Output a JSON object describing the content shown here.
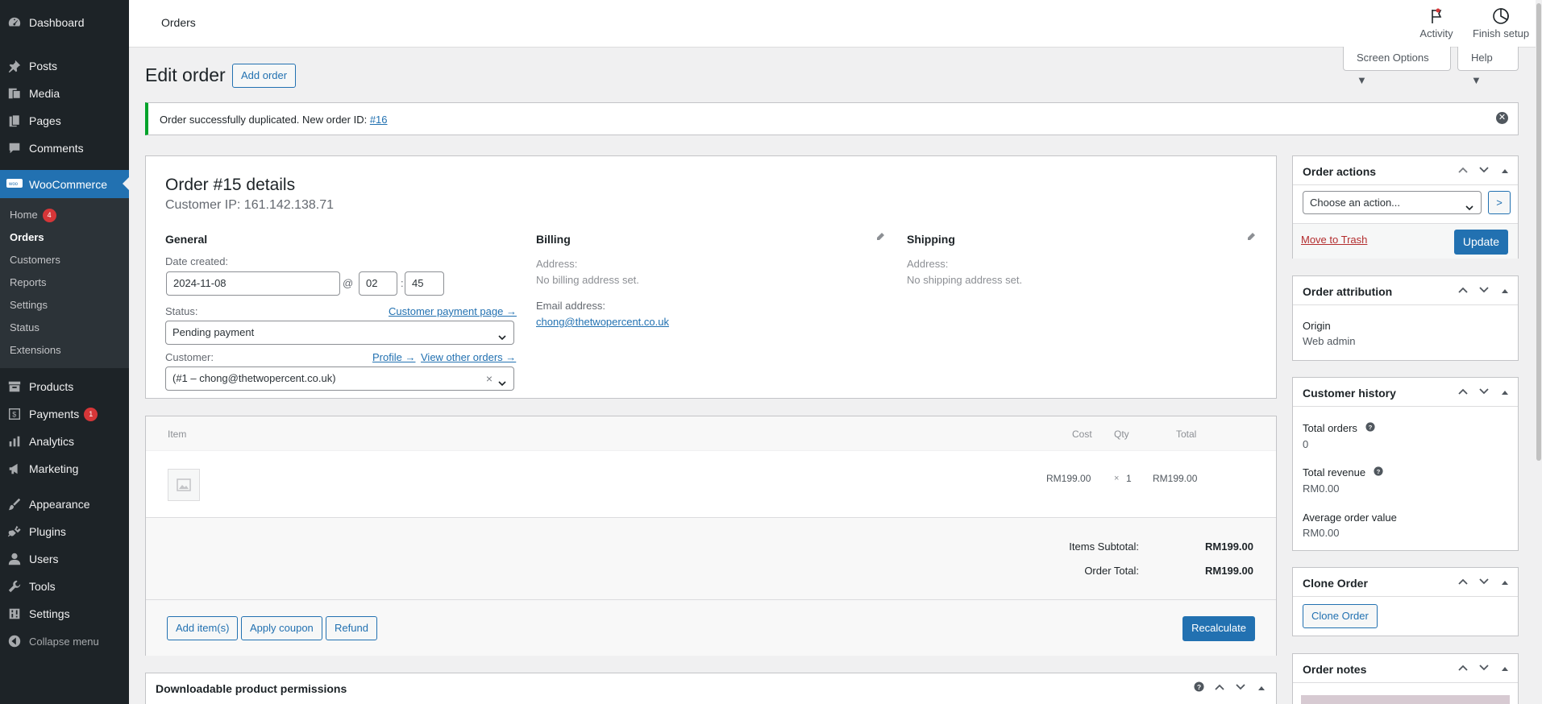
{
  "sidebar": {
    "top_items": [
      {
        "label": "Dashboard",
        "icon": "dashboard-icon"
      },
      {
        "label": "Posts",
        "icon": "pin-icon"
      },
      {
        "label": "Media",
        "icon": "media-icon"
      },
      {
        "label": "Pages",
        "icon": "pages-icon"
      },
      {
        "label": "Comments",
        "icon": "comments-icon"
      }
    ],
    "woocommerce": {
      "label": "WooCommerce",
      "icon": "woo-icon"
    },
    "submenu": [
      {
        "label": "Home",
        "badge": "4"
      },
      {
        "label": "Orders"
      },
      {
        "label": "Customers"
      },
      {
        "label": "Reports"
      },
      {
        "label": "Settings"
      },
      {
        "label": "Status"
      },
      {
        "label": "Extensions"
      }
    ],
    "bottom_items": [
      {
        "label": "Products",
        "icon": "archive-icon"
      },
      {
        "label": "Payments",
        "badge": "1",
        "icon": "payments-icon"
      },
      {
        "label": "Analytics",
        "icon": "chart-bar-icon"
      },
      {
        "label": "Marketing",
        "icon": "megaphone-icon"
      },
      {
        "label": "Appearance",
        "icon": "paintbrush-icon"
      },
      {
        "label": "Plugins",
        "icon": "plugin-icon"
      },
      {
        "label": "Users",
        "icon": "users-icon"
      },
      {
        "label": "Tools",
        "icon": "wrench-icon"
      },
      {
        "label": "Settings",
        "icon": "settings-icon"
      }
    ],
    "collapse_label": "Collapse menu"
  },
  "topbar": {
    "page_name": "Orders",
    "activity_label": "Activity",
    "finish_setup_label": "Finish setup"
  },
  "screen_options": {
    "screen_options_label": "Screen Options ▼",
    "help_label": "Help ▼"
  },
  "header": {
    "title": "Edit order",
    "add_order_label": "Add order"
  },
  "notice": {
    "text": "Order successfully duplicated. New order ID: ",
    "link": "#16"
  },
  "order": {
    "title": "Order #15 details",
    "customer_ip": "Customer IP: 161.142.138.71",
    "general": {
      "heading": "General",
      "date_label": "Date created:",
      "date_value": "2024-11-08",
      "at_sign": "@",
      "hour": "02",
      "colon": ":",
      "minute": "45",
      "status_label": "Status:",
      "payment_page_link": "Customer payment page →",
      "status_value": "Pending payment",
      "customer_label": "Customer:",
      "profile_link": "Profile →",
      "other_orders_link": "View other orders →",
      "customer_value": "(#1 – chong@thetwopercent.co.uk)",
      "clear_x": "×"
    },
    "billing": {
      "heading": "Billing",
      "address_label": "Address:",
      "address_value": "No billing address set.",
      "email_label": "Email address:",
      "email_value": "chong@thetwopercent.co.uk"
    },
    "shipping": {
      "heading": "Shipping",
      "address_label": "Address:",
      "address_value": "No shipping address set."
    }
  },
  "items": {
    "headers": {
      "item": "Item",
      "cost": "Cost",
      "qty": "Qty",
      "total": "Total"
    },
    "row": {
      "cost": "RM199.00",
      "qty_x": "×",
      "qty": "1",
      "total": "RM199.00"
    },
    "subtotal_label": "Items Subtotal:",
    "subtotal_value": "RM199.00",
    "order_total_label": "Order Total:",
    "order_total_value": "RM199.00",
    "add_items_label": "Add item(s)",
    "apply_coupon_label": "Apply coupon",
    "refund_label": "Refund",
    "recalculate_label": "Recalculate"
  },
  "downloadable": {
    "title": "Downloadable product permissions"
  },
  "order_actions": {
    "title": "Order actions",
    "select_placeholder": "Choose an action...",
    "go_label": ">",
    "trash_label": "Move to Trash",
    "update_label": "Update"
  },
  "attribution": {
    "title": "Order attribution",
    "origin_label": "Origin",
    "origin_value": "Web admin"
  },
  "customer_history": {
    "title": "Customer history",
    "total_orders_label": "Total orders",
    "total_orders_value": "0",
    "total_revenue_label": "Total revenue",
    "total_revenue_value": "RM0.00",
    "aov_label": "Average order value",
    "aov_value": "RM0.00"
  },
  "clone_order": {
    "title": "Clone Order",
    "button_label": "Clone Order"
  },
  "order_notes": {
    "title": "Order notes"
  },
  "colors": {
    "accent": "#2271b1",
    "sidebar": "#1d2327",
    "notice_success": "#00a32a",
    "badge": "#d63638"
  }
}
